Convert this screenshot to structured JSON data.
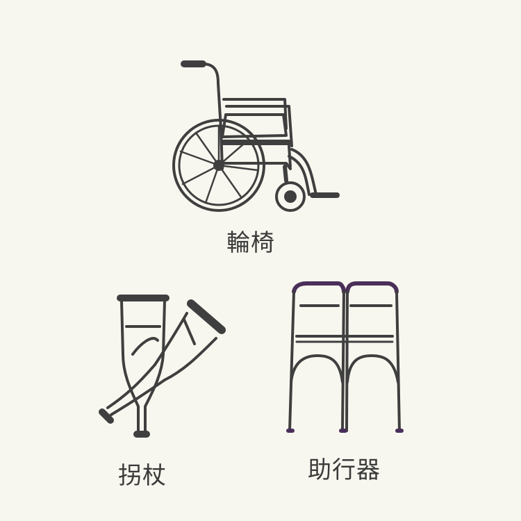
{
  "items": {
    "wheelchair": {
      "label": "輪椅",
      "icon": "wheelchair-icon"
    },
    "crutches": {
      "label": "拐杖",
      "icon": "crutches-icon"
    },
    "walker": {
      "label": "助行器",
      "icon": "walker-icon"
    }
  },
  "colors": {
    "background": "#f8f7ef",
    "line": "#3f3f3f",
    "walker_accent": "#4a2f5a"
  }
}
